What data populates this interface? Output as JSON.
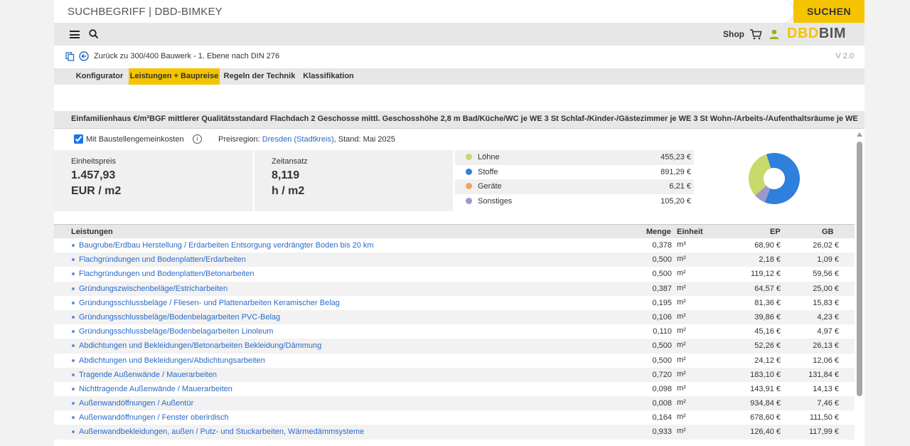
{
  "search": {
    "placeholder": "SUCHBEGRIFF | DBD-BIMKEY",
    "button_label": "SUCHEN"
  },
  "nav": {
    "shop_label": "Shop",
    "logo_part1": "DBD",
    "logo_part2": "BIM"
  },
  "breadcrumb": {
    "back_label": "Zurück zu 300/400 Bauwerk - 1. Ebene nach DIN 276",
    "version": "V 2.0"
  },
  "tabs": [
    {
      "label": "Konfigurator"
    },
    {
      "label": "Leistungen + Baupreise",
      "active": true
    },
    {
      "label": "Regeln der Technik"
    },
    {
      "label": "Klassifikation"
    }
  ],
  "title": "Einfamilienhaus €/m²BGF mittlerer Qualitätsstandard Flachdach 2 Geschosse mittl. Geschosshöhe 2,8 m Bad/Küche/WC je WE 3 St Schlaf-/Kinder-/Gästezimmer je WE 3 St Wohn-/Arbeits-/Aufenthaltsräume je WE",
  "options": {
    "checkbox_label": "Mit Baustellengemeinkosten",
    "checkbox_checked": true,
    "region_prefix": "Preisregion:",
    "region_link": "Dresden (Stadtkreis)",
    "region_suffix": ", Stand: Mai 2025"
  },
  "stats": {
    "unit_price": {
      "label": "Einheitspreis",
      "value": "1.457,93",
      "unit": "EUR / m2"
    },
    "time": {
      "label": "Zeitansatz",
      "value": "8,119",
      "unit": "h / m2"
    }
  },
  "breakdown": [
    {
      "label": "Löhne",
      "amount": "455,23 €",
      "value": 455.23,
      "color": "#c8d96a"
    },
    {
      "label": "Stoffe",
      "amount": "891,29 €",
      "value": 891.29,
      "color": "#2f7fdd"
    },
    {
      "label": "Geräte",
      "amount": "6,21 €",
      "value": 6.21,
      "color": "#f6a35a"
    },
    {
      "label": "Sonstiges",
      "amount": "105,20 €",
      "value": 105.2,
      "color": "#9a9ac9"
    }
  ],
  "table": {
    "headers": {
      "name": "Leistungen",
      "menge": "Menge",
      "einheit": "Einheit",
      "ep": "EP",
      "gb": "GB"
    },
    "rows": [
      {
        "name": "Baugrube/Erdbau Herstellung / Erdarbeiten Entsorgung verdrängter Boden bis 20 km",
        "menge": "0,378",
        "unit": "m³",
        "ep": "68,90 €",
        "gb": "26,02 €"
      },
      {
        "name": "Flachgründungen und Bodenplatten/Erdarbeiten",
        "menge": "0,500",
        "unit": "m²",
        "ep": "2,18 €",
        "gb": "1,09 €"
      },
      {
        "name": "Flachgründungen und Bodenplatten/Betonarbeiten",
        "menge": "0,500",
        "unit": "m²",
        "ep": "119,12 €",
        "gb": "59,56 €"
      },
      {
        "name": "Gründungszwischenbeläge/Estricharbeiten",
        "menge": "0,387",
        "unit": "m²",
        "ep": "64,57 €",
        "gb": "25,00 €"
      },
      {
        "name": "Gründungsschlussbeläge / Fliesen- und Plattenarbeiten Keramischer Belag",
        "menge": "0,195",
        "unit": "m²",
        "ep": "81,36 €",
        "gb": "15,83 €"
      },
      {
        "name": "Gründungsschlussbeläge/Bodenbelagarbeiten PVC-Belag",
        "menge": "0,106",
        "unit": "m²",
        "ep": "39,86 €",
        "gb": "4,23 €"
      },
      {
        "name": "Gründungsschlussbeläge/Bodenbelagarbeiten Linoleum",
        "menge": "0,110",
        "unit": "m²",
        "ep": "45,16 €",
        "gb": "4,97 €"
      },
      {
        "name": "Abdichtungen und Bekleidungen/Betonarbeiten Bekleidung/Dämmung",
        "menge": "0,500",
        "unit": "m²",
        "ep": "52,26 €",
        "gb": "26,13 €"
      },
      {
        "name": "Abdichtungen und Bekleidungen/Abdichtungsarbeiten",
        "menge": "0,500",
        "unit": "m²",
        "ep": "24,12 €",
        "gb": "12,06 €"
      },
      {
        "name": "Tragende Außenwände / Mauerarbeiten",
        "menge": "0,720",
        "unit": "m²",
        "ep": "183,10 €",
        "gb": "131,84 €"
      },
      {
        "name": "Nichttragende Außenwände / Mauerarbeiten",
        "menge": "0,098",
        "unit": "m²",
        "ep": "143,91 €",
        "gb": "14,13 €"
      },
      {
        "name": "Außenwandöffnungen / Außentür",
        "menge": "0,008",
        "unit": "m²",
        "ep": "934,84 €",
        "gb": "7,46 €"
      },
      {
        "name": "Außenwandöffnungen / Fenster oberirdisch",
        "menge": "0,164",
        "unit": "m²",
        "ep": "678,60 €",
        "gb": "111,50 €"
      },
      {
        "name": "Außenwandbekleidungen, außen / Putz- und Stuckarbeiten, Wärmedämmsysteme",
        "menge": "0,933",
        "unit": "m²",
        "ep": "126,40 €",
        "gb": "117,99 €"
      }
    ]
  }
}
